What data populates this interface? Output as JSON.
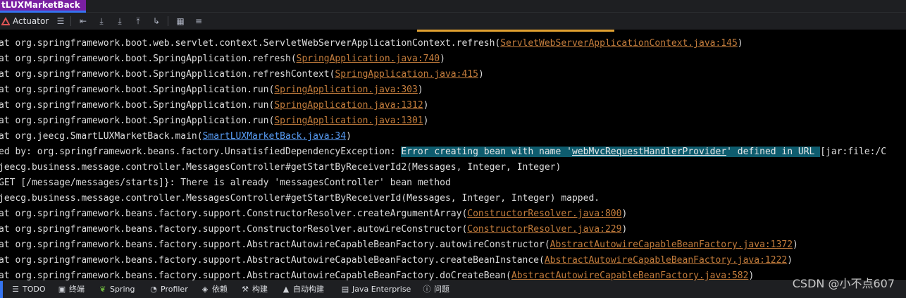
{
  "tab": {
    "title": "tLUXMarketBack"
  },
  "toolbar": {
    "actuator_label": "Actuator"
  },
  "console": {
    "lines": [
      {
        "pre": "at org.springframework.boot.web.servlet.context.ServletWebServerApplicationContext.refresh(",
        "link": "ServletWebServerApplicationContext.java:145",
        "post": ")"
      },
      {
        "pre": "at org.springframework.boot.SpringApplication.refresh(",
        "link": "SpringApplication.java:740",
        "post": ")"
      },
      {
        "pre": "at org.springframework.boot.SpringApplication.refreshContext(",
        "link": "SpringApplication.java:415",
        "post": ")"
      },
      {
        "pre": "at org.springframework.boot.SpringApplication.run(",
        "link": "SpringApplication.java:303",
        "post": ")"
      },
      {
        "pre": "at org.springframework.boot.SpringApplication.run(",
        "link": "SpringApplication.java:1312",
        "post": ")"
      },
      {
        "pre": "at org.springframework.boot.SpringApplication.run(",
        "link": "SpringApplication.java:1301",
        "post": ")"
      },
      {
        "pre": "at org.jeecg.SmartLUXMarketBack.main(",
        "link": "SmartLUXMarketBack.java:34",
        "post": ")",
        "blue": true
      },
      {
        "pre": "ed by: org.springframework.beans.factory.UnsatisfiedDependencyException: ",
        "hl1": "Error creating bean with name '",
        "hlLink": "webMvcRequestHandlerProvider",
        "hl2": "' defined in URL ",
        "post": "[jar:file:/C"
      },
      {
        "pre": "jeecg.business.message.controller.MessagesController#getStartByReceiverId2(Messages, Integer, Integer)"
      },
      {
        "pre": "GET [/message/messages/starts]}: There is already 'messagesController' bean method"
      },
      {
        "pre": "jeecg.business.message.controller.MessagesController#getStartByReceiverId(Messages, Integer, Integer) mapped."
      },
      {
        "pre": "at org.springframework.beans.factory.support.ConstructorResolver.createArgumentArray(",
        "link": "ConstructorResolver.java:800",
        "post": ")"
      },
      {
        "pre": "at org.springframework.beans.factory.support.ConstructorResolver.autowireConstructor(",
        "link": "ConstructorResolver.java:229",
        "post": ")"
      },
      {
        "pre": "at org.springframework.beans.factory.support.AbstractAutowireCapableBeanFactory.autowireConstructor(",
        "link": "AbstractAutowireCapableBeanFactory.java:1372",
        "post": ")"
      },
      {
        "pre": "at org.springframework.beans.factory.support.AbstractAutowireCapableBeanFactory.createBeanInstance(",
        "link": "AbstractAutowireCapableBeanFactory.java:1222",
        "post": ")"
      },
      {
        "pre": "at org.springframework.beans.factory.support.AbstractAutowireCapableBeanFactory.doCreateBean(",
        "link": "AbstractAutowireCapableBeanFactory.java:582",
        "post": ")"
      }
    ]
  },
  "statusbar": {
    "todo": "TODO",
    "terminal": "终端",
    "spring": "Spring",
    "profiler": "Profiler",
    "deps": "依赖",
    "build": "构建",
    "autobuild": "自动构建",
    "java_enterprise": "Java Enterprise",
    "problems": "问题"
  },
  "watermark": "CSDN @小不点607",
  "colors": {
    "tab": "#7a1fa2",
    "link": "#c47d3c",
    "blue_link": "#589df6",
    "highlight": "#0e5c6e"
  }
}
